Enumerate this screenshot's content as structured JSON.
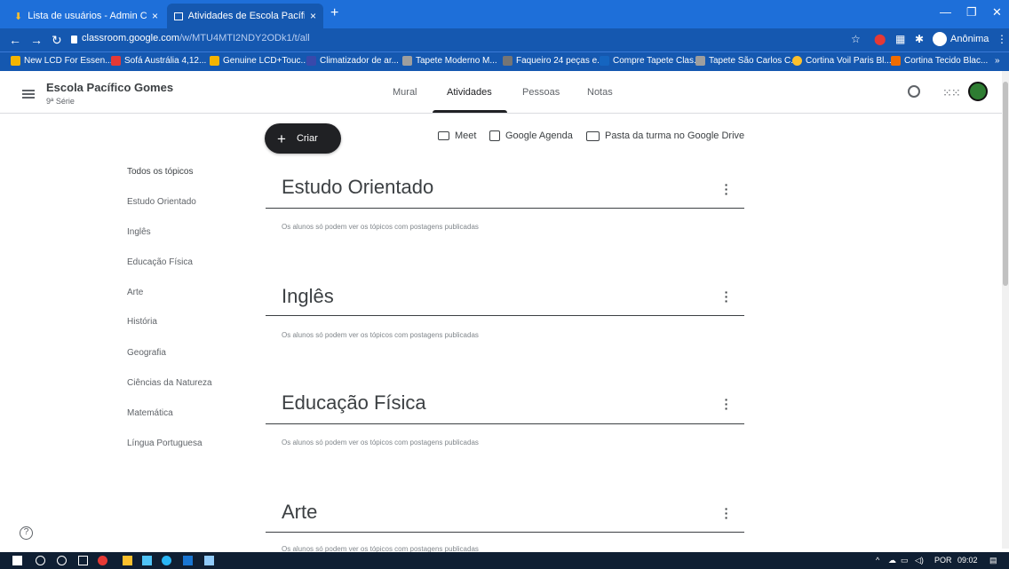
{
  "browser": {
    "tabs": [
      {
        "title": "Lista de usuários - Admin Consol",
        "close": "×"
      },
      {
        "title": "Atividades de Escola Pacífico Go",
        "close": "×"
      }
    ],
    "new_tab": "+",
    "window_controls": [
      "—",
      "❐",
      "✕"
    ],
    "url_host": "classroom.google.com",
    "url_path": "/w/MTU4MTI2NDY2ODk1/t/all",
    "profile": "Anônima",
    "bookmarks": [
      {
        "label": "New LCD For Essen...",
        "color": "#f4b400"
      },
      {
        "label": "Sofá Austrália 4,12...",
        "color": "#e53935"
      },
      {
        "label": "Genuine LCD+Touc...",
        "color": "#f4b400"
      },
      {
        "label": "Climatizador de ar...",
        "color": "#3949ab"
      },
      {
        "label": "Tapete Moderno M...",
        "color": "#9e9e9e"
      },
      {
        "label": "Faqueiro 24 peças e...",
        "color": "#757575"
      },
      {
        "label": "Compre Tapete Clas...",
        "color": "#1565c0"
      },
      {
        "label": "Tapete São Carlos C...",
        "color": "#9e9e9e"
      },
      {
        "label": "Cortina Voil Paris Bl...",
        "color": "#fbc02d"
      },
      {
        "label": "Cortina Tecido Blac...",
        "color": "#ef6c00"
      }
    ],
    "bookmarks_more": "»"
  },
  "header": {
    "class_name": "Escola Pacífico Gomes",
    "section": "9ª Série",
    "tabs": [
      "Mural",
      "Atividades",
      "Pessoas",
      "Notas"
    ],
    "selected_tab": "Atividades"
  },
  "toolbar": {
    "create_label": "Criar",
    "meet_label": "Meet",
    "calendar_label": "Google Agenda",
    "drive_label": "Pasta da turma no Google Drive"
  },
  "sidebar": {
    "items": [
      "Todos os tópicos",
      "Estudo Orientado",
      "Inglês",
      "Educação Física",
      "Arte",
      "História",
      "Geografia",
      "Ciências da Natureza",
      "Matemática",
      "Língua Portuguesa"
    ]
  },
  "topics": [
    {
      "title": "Estudo Orientado",
      "note": "Os alunos só podem ver os tópicos com postagens publicadas"
    },
    {
      "title": "Inglês",
      "note": "Os alunos só podem ver os tópicos com postagens publicadas"
    },
    {
      "title": "Educação Física",
      "note": "Os alunos só podem ver os tópicos com postagens publicadas"
    },
    {
      "title": "Arte",
      "note": "Os alunos só podem ver os tópicos com postagens publicadas"
    }
  ],
  "help_icon": "?",
  "taskbar": {
    "language": "POR",
    "time": "09:02"
  }
}
